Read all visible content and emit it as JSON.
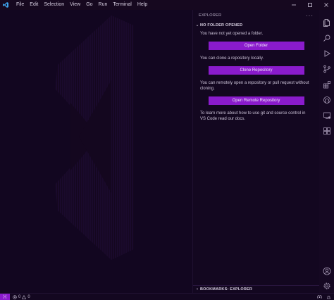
{
  "menu": [
    "File",
    "Edit",
    "Selection",
    "View",
    "Go",
    "Run",
    "Terminal",
    "Help"
  ],
  "sidebar": {
    "title": "EXPLORER",
    "section": "NO FOLDER OPENED",
    "text_1": "You have not yet opened a folder.",
    "button_open": "Open Folder",
    "text_2": "You can clone a repository locally.",
    "button_clone": "Clone Repository",
    "text_3": "You can remotely open a repository or pull request without cloning.",
    "button_remote": "Open Remote Repository",
    "text_4": "To learn more about how to use git and source control in VS Code read our docs.",
    "bookmarks": "BOOKMARKS: EXPLORER"
  },
  "status": {
    "errors": "0",
    "warnings": "0",
    "remote_icon": "remote-icon"
  },
  "colors": {
    "accent": "#8a1bcc",
    "background": "#130720"
  }
}
